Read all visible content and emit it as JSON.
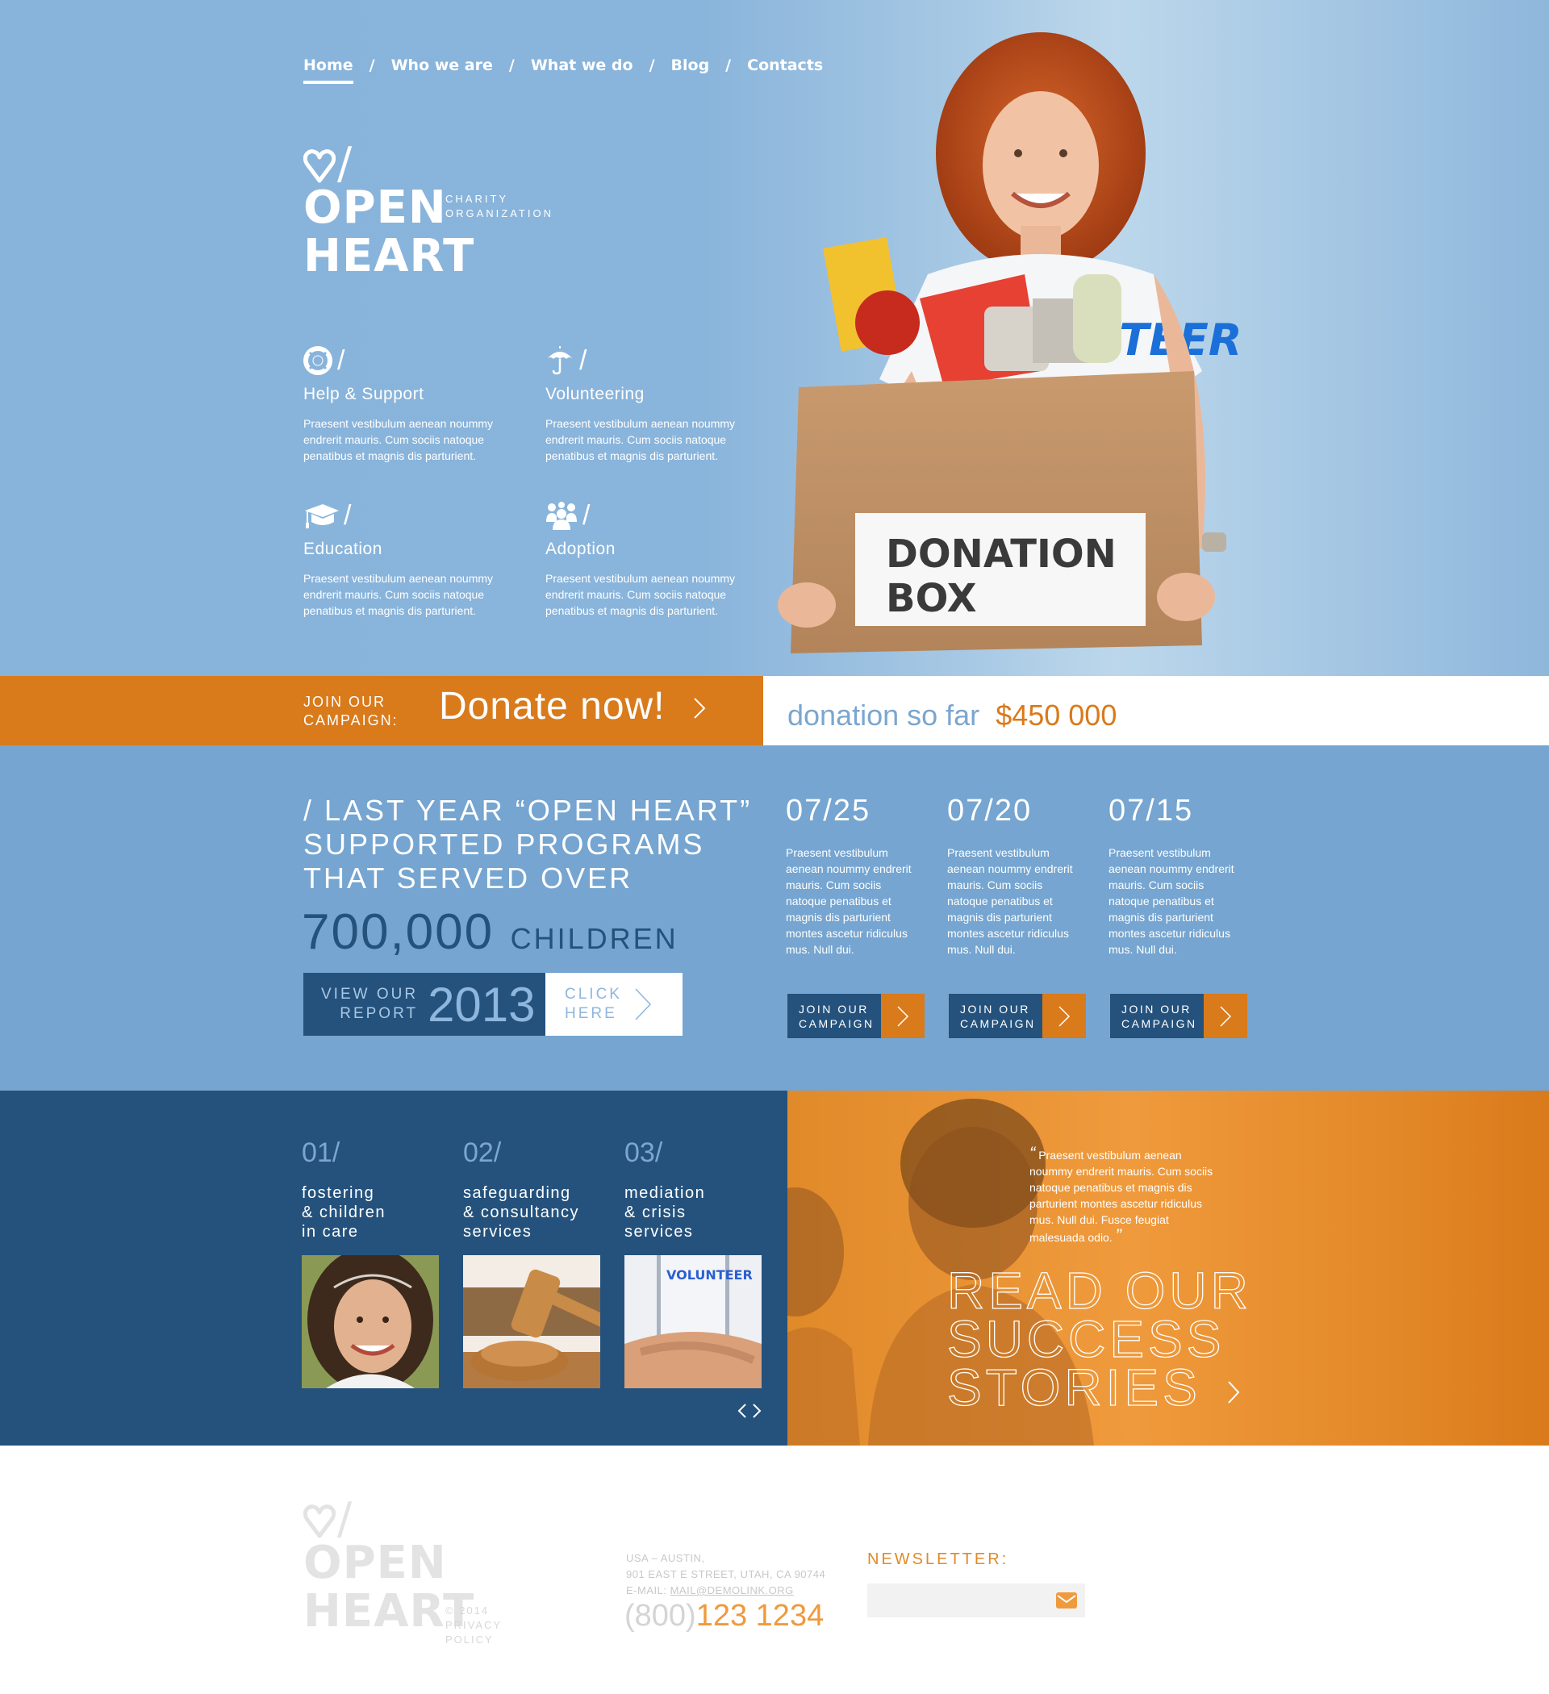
{
  "nav": {
    "items": [
      {
        "label": "Home",
        "active": true
      },
      {
        "label": "Who we are",
        "active": false
      },
      {
        "label": "What we do",
        "active": false
      },
      {
        "label": "Blog",
        "active": false
      },
      {
        "label": "Contacts",
        "active": false
      }
    ],
    "separator": "/"
  },
  "brand": {
    "line1": "OPEN",
    "line2": "HEART",
    "slash": "/",
    "subtitle_line1": "CHARITY",
    "subtitle_line2": "ORGANIZATION"
  },
  "features": [
    {
      "icon": "lifebuoy-icon",
      "title": "Help & Support",
      "text": "Praesent vestibulum aenean noummy endrerit mauris. Cum sociis natoque penatibus et magnis dis parturient."
    },
    {
      "icon": "umbrella-icon",
      "title": "Volunteering",
      "text": "Praesent vestibulum aenean noummy endrerit mauris. Cum sociis natoque penatibus et magnis dis parturient."
    },
    {
      "icon": "graduation-cap-icon",
      "title": "Education",
      "text": "Praesent vestibulum aenean noummy endrerit mauris. Cum sociis natoque penatibus et magnis dis parturient."
    },
    {
      "icon": "group-icon",
      "title": "Adoption",
      "text": "Praesent vestibulum aenean noummy endrerit mauris. Cum sociis natoque penatibus et magnis dis parturient."
    }
  ],
  "hero_photo": {
    "shirt_text": "VOLUNTEER",
    "box_text_line1": "DONATION",
    "box_text_line2": "BOX"
  },
  "donate": {
    "join_line1": "JOIN OUR",
    "join_line2": "CAMPAIGN:",
    "cta": "Donate now!",
    "total_label": "donation so far",
    "total_amount": "$450 000"
  },
  "stats": {
    "headline_line1": "/ LAST YEAR “OPEN HEART”",
    "headline_line2": "SUPPORTED PROGRAMS",
    "headline_line3": "THAT SERVED OVER",
    "number": "700,000",
    "unit": "CHILDREN",
    "report_line1": "VIEW OUR",
    "report_line2": "REPORT",
    "report_year": "2013",
    "click_line1": "CLICK",
    "click_line2": "HERE"
  },
  "news": [
    {
      "date": "07/25",
      "text": "Praesent vestibulum aenean noummy endrerit mauris. Cum sociis natoque penatibus et magnis dis parturient montes ascetur ridiculus mus. Null dui.",
      "btn_line1": "JOIN OUR",
      "btn_line2": "CAMPAIGN"
    },
    {
      "date": "07/20",
      "text": "Praesent vestibulum aenean noummy endrerit mauris. Cum sociis natoque penatibus et magnis dis parturient montes ascetur ridiculus mus. Null dui.",
      "btn_line1": "JOIN OUR",
      "btn_line2": "CAMPAIGN"
    },
    {
      "date": "07/15",
      "text": "Praesent vestibulum aenean noummy endrerit mauris. Cum sociis natoque penatibus et magnis dis parturient montes ascetur ridiculus mus. Null dui.",
      "btn_line1": "JOIN OUR",
      "btn_line2": "CAMPAIGN"
    }
  ],
  "programs": [
    {
      "num": "01/",
      "line1": "fostering",
      "line2": "& children",
      "line3": "in care",
      "image": "smiling-girl-photo"
    },
    {
      "num": "02/",
      "line1": "safeguarding",
      "line2": "& consultancy",
      "line3": "services",
      "image": "gavel-photo"
    },
    {
      "num": "03/",
      "line1": "mediation",
      "line2": "& crisis",
      "line3": "services",
      "image": "volunteers-hands-photo"
    }
  ],
  "success": {
    "quote": "Praesent vestibulum aenean noummy endrerit mauris. Cum sociis natoque penatibus et magnis dis parturient montes ascetur ridiculus mus. Null dui. Fusce feugiat malesuada odio.",
    "open_quote": "“",
    "close_quote": "”",
    "cta_line1": "READ OUR",
    "cta_line2": "SUCCESS",
    "cta_line3": "STORIES"
  },
  "footer": {
    "copyright": "© 2014",
    "privacy": "PRIVACY POLICY",
    "address_line1": "USA – AUSTIN,",
    "address_line2": "901 EAST E STREET, UTAH, CA 90744",
    "email_label": "E-MAIL:",
    "email": "MAIL@DEMOLINK.ORG",
    "phone_prefix": "(800)",
    "phone_main": "123 1234",
    "newsletter_title": "NEWSLETTER:",
    "newsletter_placeholder": ""
  },
  "colors": {
    "sky_blue": "#88b3db",
    "stats_blue": "#75a5d0",
    "navy": "#24527d",
    "orange": "#d97a1b",
    "light_orange": "#ef9a3c"
  }
}
